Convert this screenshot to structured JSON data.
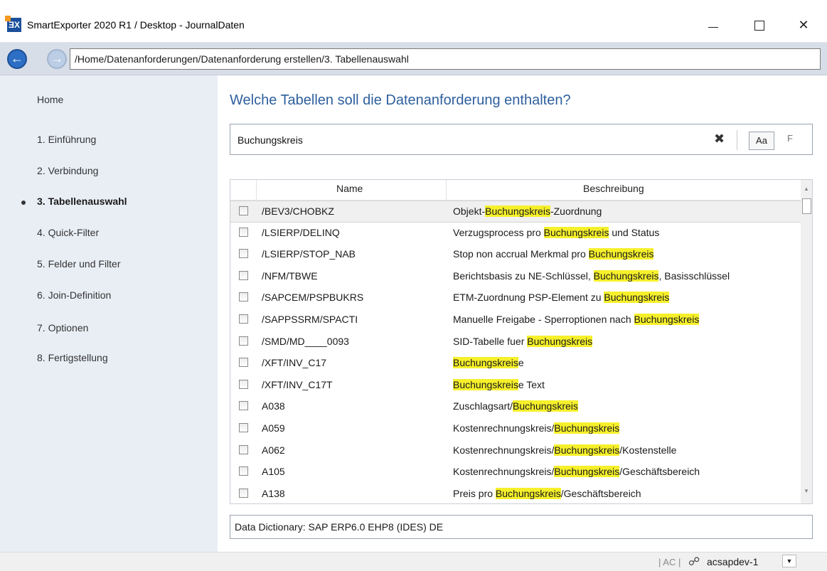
{
  "window": {
    "title": "SmartExporter 2020 R1 / Desktop - JournalDaten",
    "logo": "ƎX",
    "minimize_icon": "",
    "maximize_icon": "",
    "close_icon": "✕"
  },
  "nav": {
    "back_icon": "←",
    "forward_icon": "→",
    "breadcrumb": "/Home/Datenanforderungen/Datenanforderung erstellen/3. Tabellenauswahl"
  },
  "sidebar": {
    "items": [
      {
        "label": "Home"
      },
      {
        "label": "1. Einführung"
      },
      {
        "label": "2. Verbindung"
      },
      {
        "label": "3. Tabellenauswahl",
        "active": true
      },
      {
        "label": "4. Quick-Filter"
      },
      {
        "label": "5. Felder und Filter"
      },
      {
        "label": "6. Join-Definition"
      },
      {
        "label": "7. Optionen"
      },
      {
        "label": "8. Fertigstellung"
      }
    ]
  },
  "main": {
    "title": "Welche Tabellen soll die Datenanforderung enthalten?",
    "search": {
      "value": "Buchungskreis",
      "clear_icon": "✖",
      "case_label": "Aa",
      "filter_label": "F"
    },
    "table": {
      "columns": [
        "Name",
        "Beschreibung"
      ],
      "highlight": "Buchungskreis",
      "rows": [
        {
          "name": "/BEV3/CHOBKZ",
          "desc_pre": "Objekt-",
          "desc_hl": "Buchungskreis",
          "desc_post": "-Zuordnung",
          "selected": true
        },
        {
          "name": "/LSIERP/DELINQ",
          "desc_pre": "Verzugsprocess pro ",
          "desc_hl": "Buchungskreis",
          "desc_post": " und Status"
        },
        {
          "name": "/LSIERP/STOP_NAB",
          "desc_pre": "Stop non accrual Merkmal pro ",
          "desc_hl": "Buchungskreis",
          "desc_post": ""
        },
        {
          "name": "/NFM/TBWE",
          "desc_pre": "Berichtsbasis zu NE-Schlüssel, ",
          "desc_hl": "Buchungskreis",
          "desc_post": ", Basisschlüssel"
        },
        {
          "name": "/SAPCEM/PSPBUKRS",
          "desc_pre": "ETM-Zuordnung PSP-Element zu ",
          "desc_hl": "Buchungskreis",
          "desc_post": ""
        },
        {
          "name": "/SAPPSSRM/SPACTI",
          "desc_pre": "Manuelle Freigabe - Sperroptionen nach ",
          "desc_hl": "Buchungskreis",
          "desc_post": ""
        },
        {
          "name": "/SMD/MD____0093",
          "desc_pre": "SID-Tabelle fuer ",
          "desc_hl": "Buchungskreis",
          "desc_post": ""
        },
        {
          "name": "/XFT/INV_C17",
          "desc_pre": "",
          "desc_hl": "Buchungskreis",
          "desc_post": "e"
        },
        {
          "name": "/XFT/INV_C17T",
          "desc_pre": "",
          "desc_hl": "Buchungskreis",
          "desc_post": "e Text"
        },
        {
          "name": "A038",
          "desc_pre": "Zuschlagsart/",
          "desc_hl": "Buchungskreis",
          "desc_post": ""
        },
        {
          "name": "A059",
          "desc_pre": "Kostenrechnungskreis/",
          "desc_hl": "Buchungskreis",
          "desc_post": ""
        },
        {
          "name": "A062",
          "desc_pre": "Kostenrechnungskreis/",
          "desc_hl": "Buchungskreis",
          "desc_post": "/Kostenstelle"
        },
        {
          "name": "A105",
          "desc_pre": "Kostenrechnungskreis/",
          "desc_hl": "Buchungskreis",
          "desc_post": "/Geschäftsbereich"
        },
        {
          "name": "A138",
          "desc_pre": "Preis pro ",
          "desc_hl": "Buchungskreis",
          "desc_post": "/Geschäftsbereich"
        }
      ]
    },
    "data_dictionary": "Data Dictionary: SAP ERP6.0 EHP8 (IDES) DE"
  },
  "status": {
    "ac_label": "| AC |",
    "connection": "acsapdev-1",
    "connection_icon": "☍",
    "dropdown_icon": "▼"
  },
  "colors": {
    "accent": "#2e5f9e",
    "highlight": "#f6f02b",
    "sidebar_bg": "#e9eef5"
  }
}
